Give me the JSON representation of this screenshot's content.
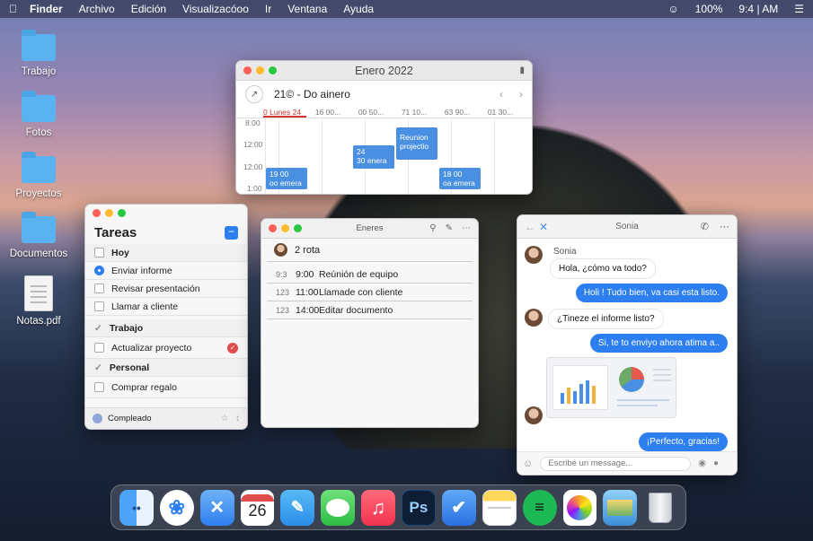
{
  "menubar": {
    "app": "Finder",
    "items": [
      "Archivo",
      "Edición",
      "Visualizacóoo",
      "Ir",
      "Ventana",
      "Ayuda"
    ],
    "battery": "100%",
    "time": "9:4 | AM"
  },
  "desktop": {
    "icons": [
      "Trabajo",
      "Fotos",
      "Proyectos",
      "Documentos",
      "Notas.pdf"
    ]
  },
  "calendar": {
    "title": "Enero 2022",
    "header": "21© - Do ainero",
    "days": [
      "0 Lunes 24",
      "16 00...",
      "00 50...",
      "71 10...",
      "63 90...",
      "01 30..."
    ],
    "times": [
      "8:00",
      "12:00",
      "12:00",
      "1:00"
    ],
    "events": [
      {
        "a": "19 00",
        "b": "oo emera"
      },
      {
        "a": "24",
        "b": "30 enera"
      },
      {
        "a": "Reunion",
        "b": "projectio"
      },
      {
        "a": "18 00",
        "b": "oa emera"
      }
    ]
  },
  "tasks": {
    "title": "Tareas",
    "sections": [
      {
        "name": "Hoy",
        "items": [
          "Enviar informe",
          "Revisar presentación",
          "Llamar a cliente"
        ]
      },
      {
        "name": "Trabajo",
        "items": [
          "Actualizar proyecto"
        ]
      },
      {
        "name": "Personal",
        "items": [
          "Comprar regalo"
        ]
      }
    ],
    "footer": "Compleado"
  },
  "notes": {
    "title": "Eneres",
    "header": "2 rota",
    "rows": [
      {
        "id": "9:3",
        "time": "9:00",
        "text": "Reúnión de equipo"
      },
      {
        "id": "123",
        "time": "11:00",
        "text": "Llamade con cliente"
      },
      {
        "id": "123",
        "time": "14:00",
        "text": "Editar documento"
      }
    ]
  },
  "messages": {
    "title": "Sonia",
    "contact": "Sonia",
    "msgs": [
      "Hola, ¿cómo va todo?",
      "Holi ! Tudo bien, va casi esta listo.",
      "¿Tineze el informe listo?",
      "Si, te to enviyo ahora atima a..",
      "¡Perfecto, gracias!"
    ],
    "placeholder": "Escribé un message..."
  },
  "dock": {
    "calendar_day": "26",
    "ps": "Ps"
  },
  "colors": {
    "accent": "#2d7ff0",
    "today": "#d0342c",
    "folder": "#5ab3f0"
  }
}
